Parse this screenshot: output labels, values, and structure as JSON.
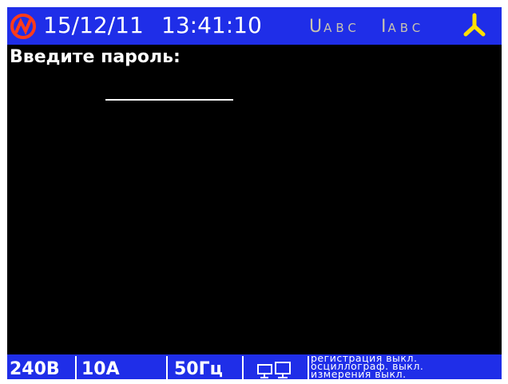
{
  "header": {
    "date": "15/12/11",
    "time": "13:41:10",
    "voltage_indicator": {
      "main": "U",
      "phases": "ABC"
    },
    "current_indicator": {
      "main": "I",
      "phases": "ABC"
    },
    "icons": {
      "logo": "device-logo-icon",
      "wiring": "three-phase-star-icon"
    },
    "colors": {
      "bar": "#1f2ee8",
      "indicator_dim": "#c7c2b0",
      "accent": "#ffe000",
      "logo": "#ff3b1a"
    }
  },
  "main": {
    "prompt": "Введите пароль:",
    "password_value": ""
  },
  "status": {
    "voltage": "240В",
    "current": "10А",
    "frequency": "50Гц",
    "connection_icon": "network-computers-icon",
    "modes": [
      "регистрация  выкл.",
      "осциллограф.  выкл.",
      "измерения  выкл."
    ]
  }
}
